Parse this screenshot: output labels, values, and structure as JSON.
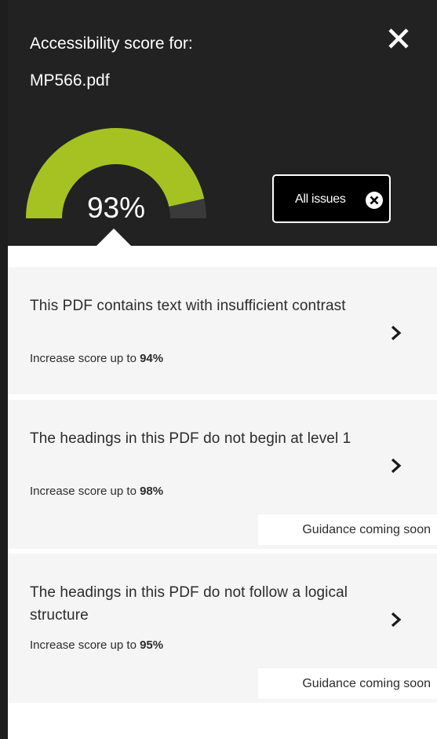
{
  "header": {
    "title": "Accessibility score for:",
    "filename": "MP566.pdf",
    "close_icon": "close-icon"
  },
  "score": {
    "value": 93,
    "label": "93%",
    "fill_color": "#a6c222",
    "track_color": "#3a3a3a"
  },
  "all_issues": {
    "label": "All issues",
    "icon": "circle-x-icon"
  },
  "issues": [
    {
      "title": "This PDF contains text with insufficient contrast",
      "increase_prefix": "Increase score up to ",
      "increase_value": "94%",
      "guidance": ""
    },
    {
      "title": "The headings in this PDF do not begin at level 1",
      "increase_prefix": "Increase score up to ",
      "increase_value": "98%",
      "guidance": "Guidance coming soon"
    },
    {
      "title": "The headings in this PDF do not follow a logical structure",
      "increase_prefix": "Increase score up to ",
      "increase_value": "95%",
      "guidance": "Guidance coming soon"
    }
  ],
  "colors": {
    "header_bg": "#222222",
    "card_bg": "#f5f5f5",
    "text": "#2c2c2c"
  }
}
